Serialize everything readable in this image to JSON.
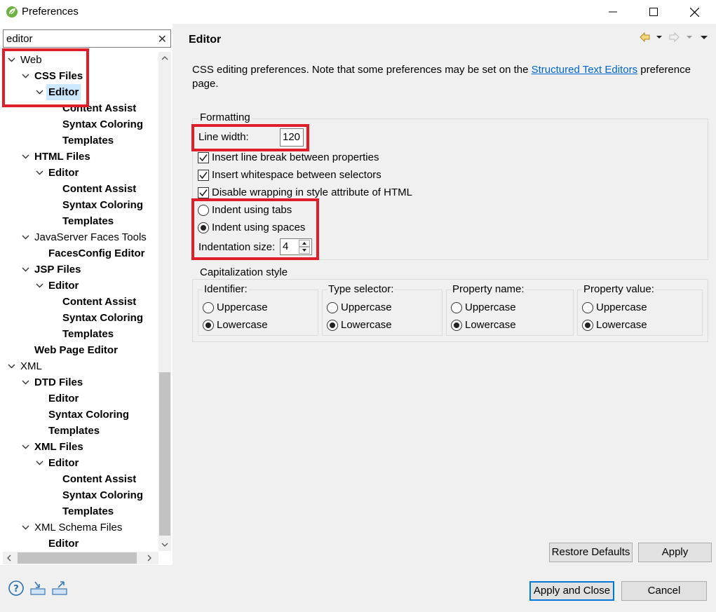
{
  "window": {
    "title": "Preferences",
    "app_icon": "spring-leaf-icon",
    "controls": [
      "minimize-icon",
      "maximize-icon",
      "close-icon"
    ]
  },
  "filter": {
    "value": "editor",
    "clear_icon": "clear-icon"
  },
  "tree": [
    {
      "label": "Web",
      "level": 0,
      "expanded": true,
      "bold": false
    },
    {
      "label": "CSS Files",
      "level": 1,
      "expanded": true,
      "bold": true
    },
    {
      "label": "Editor",
      "level": 2,
      "expanded": true,
      "bold": true,
      "selected": true
    },
    {
      "label": "Content Assist",
      "level": 3,
      "bold": true
    },
    {
      "label": "Syntax Coloring",
      "level": 3,
      "bold": true
    },
    {
      "label": "Templates",
      "level": 3,
      "bold": true
    },
    {
      "label": "HTML Files",
      "level": 1,
      "expanded": true,
      "bold": true
    },
    {
      "label": "Editor",
      "level": 2,
      "expanded": true,
      "bold": true
    },
    {
      "label": "Content Assist",
      "level": 3,
      "bold": true
    },
    {
      "label": "Syntax Coloring",
      "level": 3,
      "bold": true
    },
    {
      "label": "Templates",
      "level": 3,
      "bold": true
    },
    {
      "label": "JavaServer Faces Tools",
      "level": 1,
      "expanded": true,
      "bold": false
    },
    {
      "label": "FacesConfig Editor",
      "level": 2,
      "bold": true
    },
    {
      "label": "JSP Files",
      "level": 1,
      "expanded": true,
      "bold": true
    },
    {
      "label": "Editor",
      "level": 2,
      "expanded": true,
      "bold": true
    },
    {
      "label": "Content Assist",
      "level": 3,
      "bold": true
    },
    {
      "label": "Syntax Coloring",
      "level": 3,
      "bold": true
    },
    {
      "label": "Templates",
      "level": 3,
      "bold": true
    },
    {
      "label": "Web Page Editor",
      "level": 1,
      "bold": true
    },
    {
      "label": "XML",
      "level": 0,
      "expanded": true,
      "bold": false
    },
    {
      "label": "DTD Files",
      "level": 1,
      "expanded": true,
      "bold": true
    },
    {
      "label": "Editor",
      "level": 2,
      "bold": true
    },
    {
      "label": "Syntax Coloring",
      "level": 2,
      "bold": true
    },
    {
      "label": "Templates",
      "level": 2,
      "bold": true
    },
    {
      "label": "XML Files",
      "level": 1,
      "expanded": true,
      "bold": true
    },
    {
      "label": "Editor",
      "level": 2,
      "expanded": true,
      "bold": true
    },
    {
      "label": "Content Assist",
      "level": 3,
      "bold": true
    },
    {
      "label": "Syntax Coloring",
      "level": 3,
      "bold": true
    },
    {
      "label": "Templates",
      "level": 3,
      "bold": true
    },
    {
      "label": "XML Schema Files",
      "level": 1,
      "expanded": true,
      "bold": false
    },
    {
      "label": "Editor",
      "level": 2,
      "bold": true
    }
  ],
  "page": {
    "title": "Editor",
    "desc_before": "CSS editing preferences.  Note that some preferences may be set on the ",
    "desc_link": "Structured Text Editors",
    "desc_after": " preference page."
  },
  "formatting": {
    "legend": "Formatting",
    "line_width_label": "Line width:",
    "line_width_value": "120",
    "opt_line_break": "Insert line break between properties",
    "opt_whitespace": "Insert whitespace between selectors",
    "opt_disable_wrapping": "Disable wrapping in style attribute of HTML",
    "indent_tabs": "Indent using tabs",
    "indent_spaces": "Indent using spaces",
    "indentation_size_label": "Indentation size:",
    "indentation_size_value": "4"
  },
  "capitalization": {
    "legend": "Capitalization style",
    "groups": [
      {
        "title": "Identifier:",
        "upper": "Uppercase",
        "lower": "Lowercase",
        "selected": "lower"
      },
      {
        "title": "Type selector:",
        "upper": "Uppercase",
        "lower": "Lowercase",
        "selected": "lower"
      },
      {
        "title": "Property name:",
        "upper": "Uppercase",
        "lower": "Lowercase",
        "selected": "lower"
      },
      {
        "title": "Property value:",
        "upper": "Uppercase",
        "lower": "Lowercase",
        "selected": "lower"
      }
    ]
  },
  "buttons": {
    "restore_defaults": "Restore Defaults",
    "apply": "Apply",
    "apply_and_close": "Apply and Close",
    "cancel": "Cancel"
  },
  "bottom_icons": [
    "help-icon",
    "import-icon",
    "export-icon"
  ],
  "colors": {
    "highlight_red": "#e01e2a",
    "link": "#0066cc",
    "selection": "#cce8ff",
    "default_button_border": "#0078d7"
  }
}
